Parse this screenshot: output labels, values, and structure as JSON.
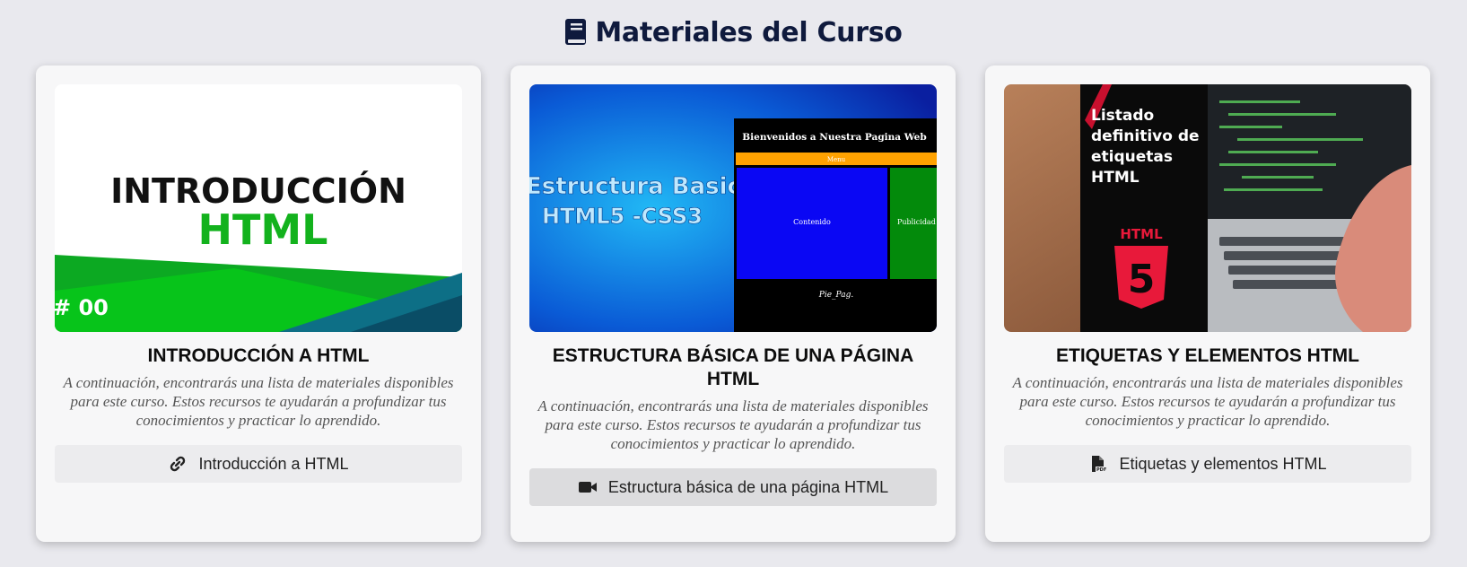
{
  "header": {
    "title": "Materiales del Curso",
    "icon": "book-icon",
    "color": "#0f1a3d"
  },
  "cards": [
    {
      "thumb": {
        "line1": "INTRODUCCIÓN",
        "line2": "HTML",
        "badge": "# 00"
      },
      "title": "INTRODUCCIÓN A HTML",
      "description": "A continuación, encontrarás una lista de materiales disponibles para este curso. Estos recursos te ayudarán a profundizar tus conocimientos y practicar lo aprendido.",
      "link": {
        "icon": "link-icon",
        "label": "Introducción a HTML"
      }
    },
    {
      "thumb": {
        "line1": "Estructura Basica",
        "line2": "HTML5 -CSS3",
        "page_header": "Bienvenidos a Nuestra Pagina Web",
        "menu": "Menu",
        "content": "Contenido",
        "ads": "Publicidad",
        "footer": "Pie_Pag."
      },
      "title": "ESTRUCTURA BÁSICA DE UNA PÁGINA HTML",
      "description": "A continuación, encontrarás una lista de materiales disponibles para este curso. Estos recursos te ayudarán a profundizar tus conocimientos y practicar lo aprendido.",
      "link": {
        "icon": "video-icon",
        "label": "Estructura básica de una página HTML"
      }
    },
    {
      "thumb": {
        "line1": "Listado",
        "line2": "definitivo de",
        "line3": "etiquetas",
        "line4": "HTML",
        "logo_label": "HTML",
        "logo_number": "5"
      },
      "title": "ETIQUETAS Y ELEMENTOS HTML",
      "description": "A continuación, encontrarás una lista de materiales disponibles para este curso. Estos recursos te ayudarán a profundizar tus conocimientos y practicar lo aprendido.",
      "link": {
        "icon": "pdf-file-icon",
        "label": "Etiquetas y elementos HTML"
      }
    }
  ]
}
